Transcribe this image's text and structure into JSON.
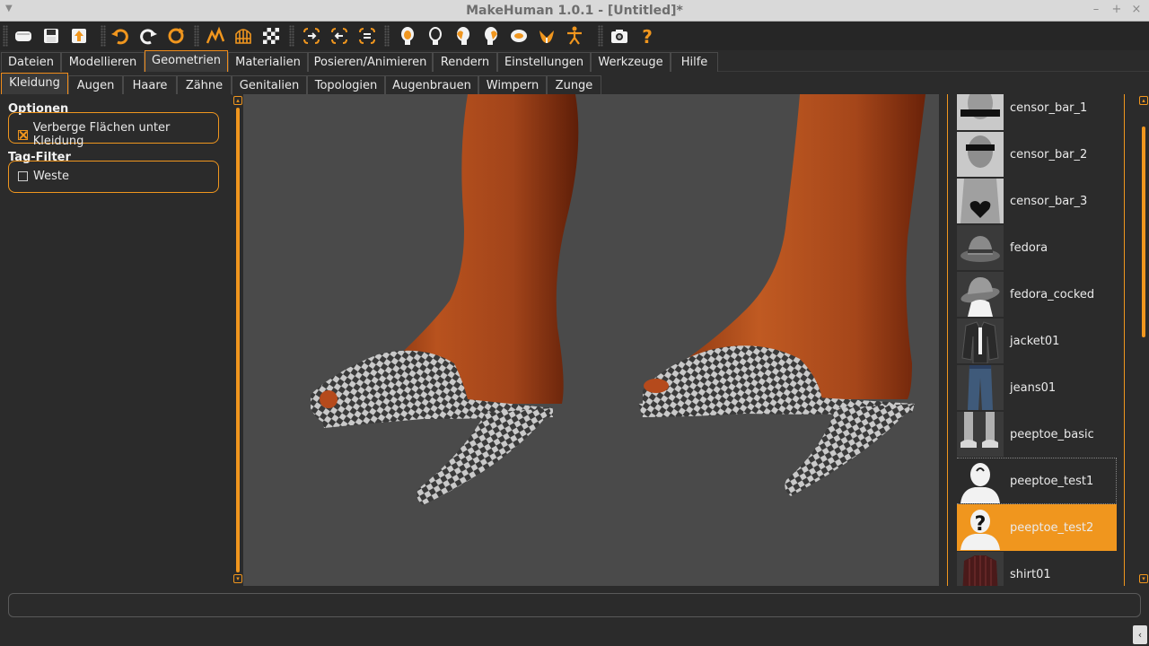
{
  "window": {
    "title": "MakeHuman 1.0.1 - [Untitled]*",
    "controls": [
      "–",
      "+",
      "×"
    ]
  },
  "toolbar": {
    "icons": [
      "load-icon",
      "save-icon",
      "export-icon",
      "undo-icon",
      "redo-icon",
      "reset-icon",
      "smooth-icon",
      "wireframe-icon",
      "checker-icon",
      "front-view-icon",
      "back-view-icon",
      "side-view-icon",
      "head-front-icon",
      "head-back-icon",
      "head-left-icon",
      "head-right-icon",
      "head-top-icon",
      "head-bottom-icon",
      "pose-icon",
      "screenshot-icon",
      "help-icon"
    ]
  },
  "main_tabs": [
    {
      "label": "Dateien"
    },
    {
      "label": "Modellieren"
    },
    {
      "label": "Geometrien",
      "active": true
    },
    {
      "label": "Materialien"
    },
    {
      "label": "Posieren/Animieren"
    },
    {
      "label": "Rendern"
    },
    {
      "label": "Einstellungen"
    },
    {
      "label": "Werkzeuge"
    },
    {
      "label": "Hilfe"
    }
  ],
  "sub_tabs": [
    {
      "label": "Kleidung",
      "active": true
    },
    {
      "label": "Augen"
    },
    {
      "label": "Haare"
    },
    {
      "label": "Zähne"
    },
    {
      "label": "Genitalien"
    },
    {
      "label": "Topologien"
    },
    {
      "label": "Augenbrauen"
    },
    {
      "label": "Wimpern"
    },
    {
      "label": "Zunge"
    }
  ],
  "options": {
    "title": "Optionen",
    "hide_faces_label": "Verberge Flächen unter Kleidung",
    "hide_faces_checked": true
  },
  "tag_filter": {
    "title": "Tag-Filter",
    "weste_label": "Weste",
    "weste_checked": false
  },
  "clothes_list": [
    {
      "label": "censor_bar_1"
    },
    {
      "label": "censor_bar_2"
    },
    {
      "label": "censor_bar_3"
    },
    {
      "label": "fedora"
    },
    {
      "label": "fedora_cocked"
    },
    {
      "label": "jacket01"
    },
    {
      "label": "jeans01"
    },
    {
      "label": "peeptoe_basic"
    },
    {
      "label": "peeptoe_test1",
      "focused": true
    },
    {
      "label": "peeptoe_test2",
      "selected": true
    },
    {
      "label": "shirt01"
    }
  ],
  "colors": {
    "accent": "#f0961e",
    "background": "#2b2b2b",
    "viewport": "#4a4a4a"
  }
}
